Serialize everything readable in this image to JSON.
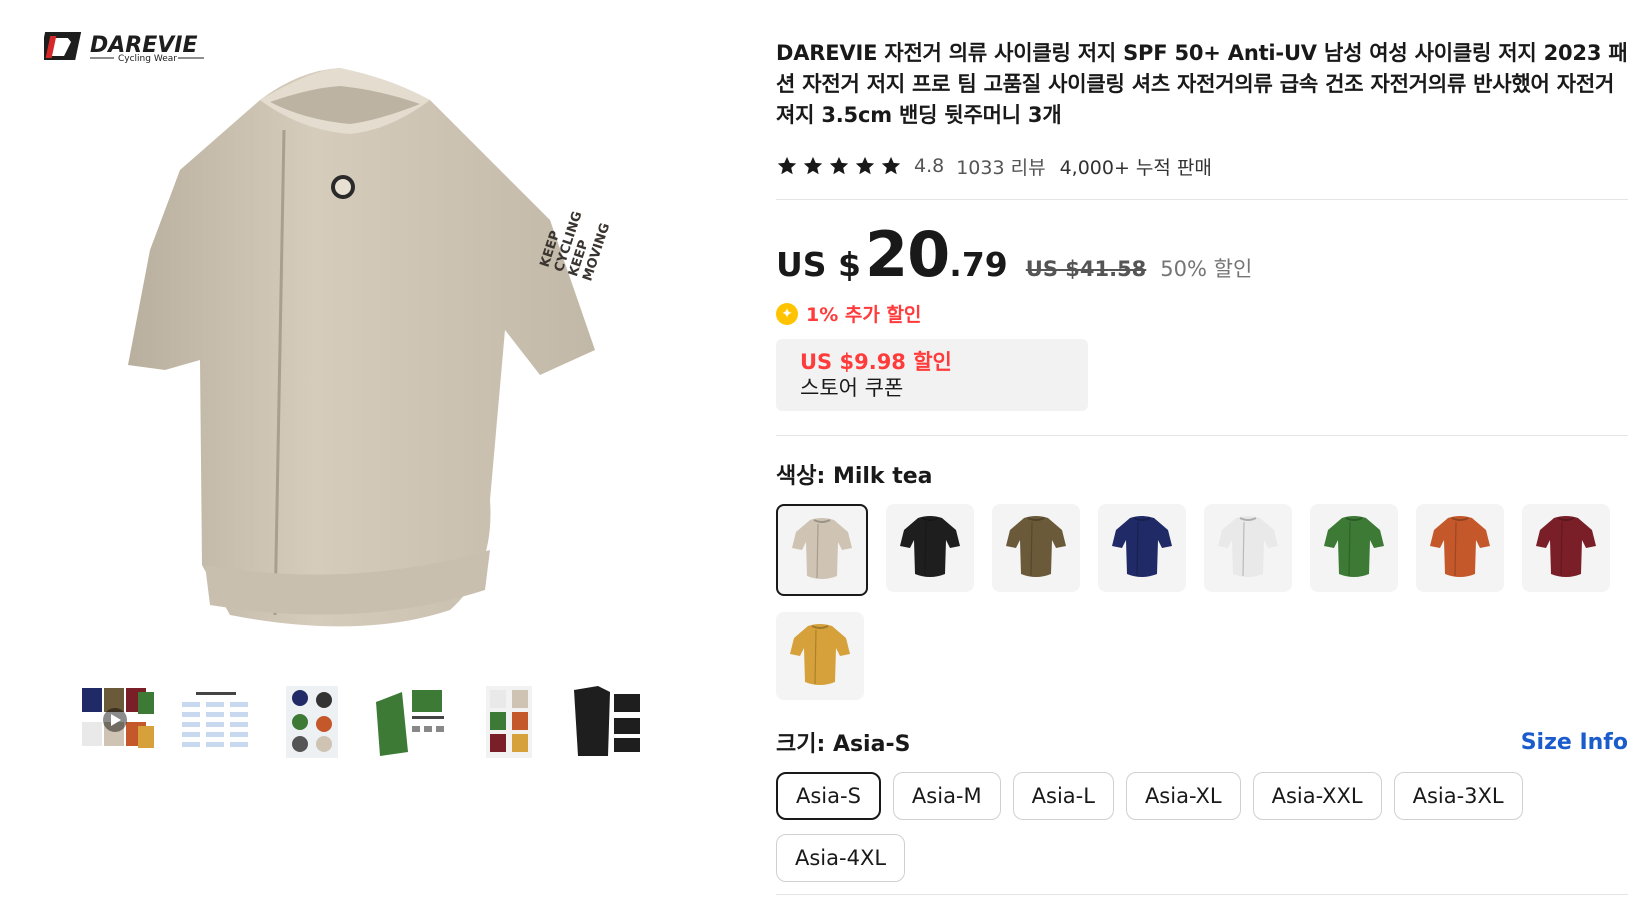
{
  "brand": {
    "name": "DAREVIE",
    "tagline": "Cycling Wear"
  },
  "product": {
    "title": "DAREVIE 자전거 의류 사이클링 저지 SPF 50+ Anti-UV 남성 여성 사이클링 저지 2023 패션 자전거 저지 프로 팀 고품질 사이클링 셔츠 자전거의류 급속 건조 자전거의류 반사했어 자전거 져지 3.5cm 밴딩 뒷주머니 3개",
    "rating": "4.8",
    "stars": 5,
    "reviews": "1033 리뷰",
    "sold": "4,000+ 누적 판매"
  },
  "price": {
    "currency": "US $",
    "integer": "20",
    "decimal": ".79",
    "original": "US $41.58",
    "discount": "50% 할인",
    "extra_discount": "1% 추가 할인"
  },
  "coupon": {
    "amount": "US $9.98 할인",
    "label": "스토어 쿠폰"
  },
  "color": {
    "label": "색상: ",
    "selected": "Milk tea",
    "options": [
      {
        "name": "milk-tea",
        "hex": "#cfc4b3"
      },
      {
        "name": "black",
        "hex": "#1e1e1e"
      },
      {
        "name": "olive-brown",
        "hex": "#6b5a3a"
      },
      {
        "name": "navy",
        "hex": "#1f2a66"
      },
      {
        "name": "white",
        "hex": "#e9e9ea"
      },
      {
        "name": "green",
        "hex": "#3c7a35"
      },
      {
        "name": "orange",
        "hex": "#c4582b"
      },
      {
        "name": "burgundy",
        "hex": "#7a1f28"
      },
      {
        "name": "mustard",
        "hex": "#d6a13a"
      }
    ]
  },
  "size": {
    "label": "크기: ",
    "selected": "Asia-S",
    "size_info": "Size Info",
    "options": [
      "Asia-S",
      "Asia-M",
      "Asia-L",
      "Asia-XL",
      "Asia-XXL",
      "Asia-3XL",
      "Asia-4XL"
    ]
  },
  "gallery": {
    "main_color": "#cdc3b3",
    "sleeve_text": [
      "KEEP",
      "CYCLING",
      "KEEP",
      "MOVING"
    ],
    "thumbnails": [
      "colors-grid-video",
      "size-chart",
      "riders-collage",
      "green-detail",
      "color-collage",
      "black-detail"
    ]
  },
  "colors": {
    "accent_red": "#ff3b3b",
    "link_blue": "#1a5ccc",
    "coin_yellow": "#ffc300"
  }
}
